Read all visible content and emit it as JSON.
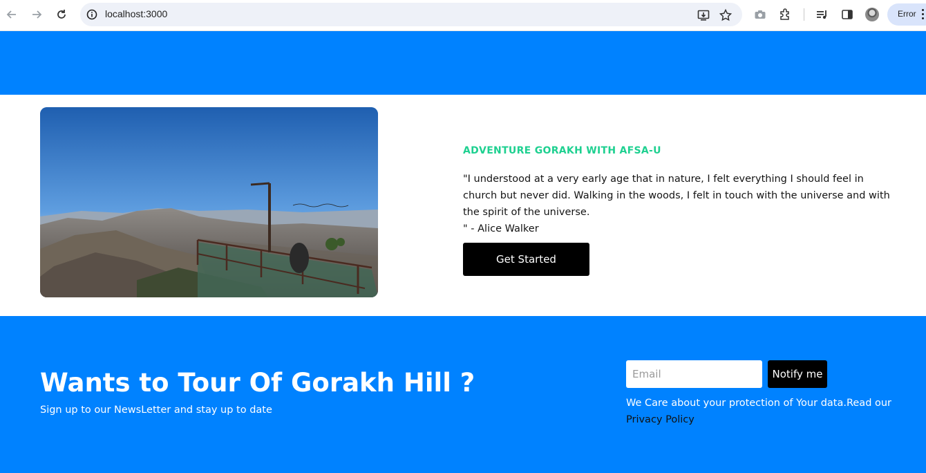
{
  "browser": {
    "url": "localhost:3000",
    "profile_status": "Error",
    "icons": {
      "back": "arrow-left-icon",
      "forward": "arrow-right-icon",
      "reload": "reload-icon",
      "site_info": "info-icon",
      "install_app": "install-app-icon",
      "bookmark": "star-icon",
      "screenshot": "camera-icon",
      "extensions": "puzzle-icon",
      "media": "media-queue-icon",
      "side_panel": "side-panel-icon",
      "profile": "avatar",
      "menu": "kebab-menu-icon"
    }
  },
  "hero": {
    "kicker": "ADVENTURE GORAKH WITH AFSA-U",
    "quote": "\"I understood at a very early age that in nature, I felt everything I should feel in church but never did. Walking in the woods, I felt in touch with the universe and with the spirit of the universe.",
    "author": "\" - Alice Walker",
    "cta_label": "Get Started",
    "image_semantic": "mountain-viewpoint-photo"
  },
  "newsletter": {
    "title": "Wants to Tour Of Gorakh Hill ?",
    "subtitle": "Sign up to our NewsLetter and stay up to date",
    "email_placeholder": "Email",
    "notify_label": "Notify me",
    "note_text": "We Care about your protection of Your data.Read our ",
    "privacy_link": "Privacy Policy"
  },
  "colors": {
    "brand_blue": "#0082ff",
    "accent_green": "#1ed090",
    "button_black": "#000000"
  }
}
